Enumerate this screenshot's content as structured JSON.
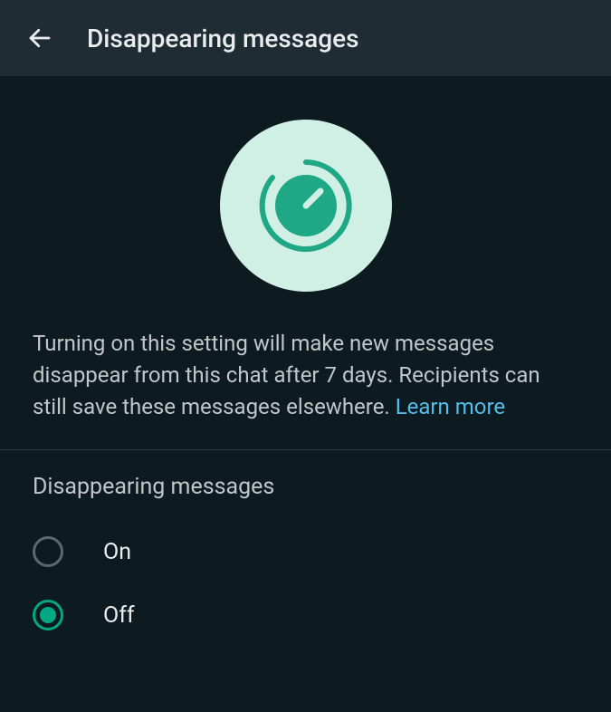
{
  "header": {
    "title": "Disappearing messages"
  },
  "description": {
    "text": "Turning on this setting will make new messages disappear from this chat after 7 days. Recipients can still save these messages elsewhere. ",
    "learn_more": "Learn more"
  },
  "section": {
    "title": "Disappearing messages"
  },
  "options": {
    "on": {
      "label": "On",
      "selected": false
    },
    "off": {
      "label": "Off",
      "selected": true
    }
  },
  "colors": {
    "accent": "#00a884",
    "link": "#53bdeb",
    "background": "#0d1a1f",
    "header_bg": "#1f2c33"
  }
}
